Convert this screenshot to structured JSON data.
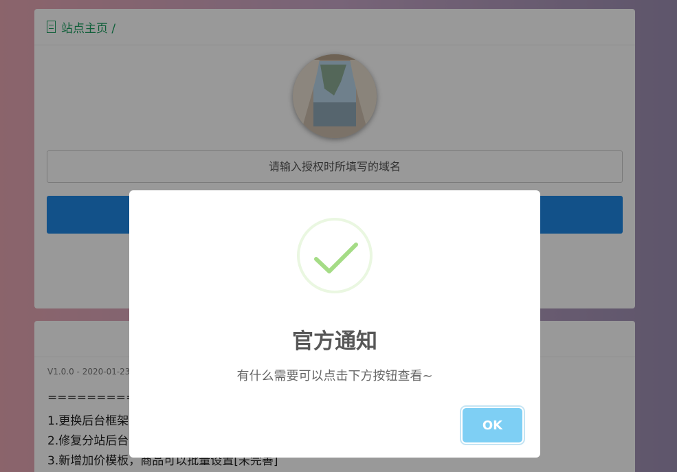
{
  "header": {
    "breadcrumb": "站点主页 /"
  },
  "form": {
    "domain_placeholder": "请输入授权时所填写的域名"
  },
  "changelog": {
    "version": "V1.0.0 - 2020-01-23",
    "lines": [
      "==========",
      "1.更换后台框架",
      "2.修复分站后台",
      "3.新增加价模板，商品可以批量设置[未完善]"
    ]
  },
  "modal": {
    "title": "官方通知",
    "text": "有什么需要可以点击下方按钮查看~",
    "ok_label": "OK"
  },
  "colors": {
    "breadcrumb": "#1a9f60",
    "submit_button": "#1e88e5",
    "success_check": "#a5dc86",
    "ok_button": "#7ecff4"
  }
}
